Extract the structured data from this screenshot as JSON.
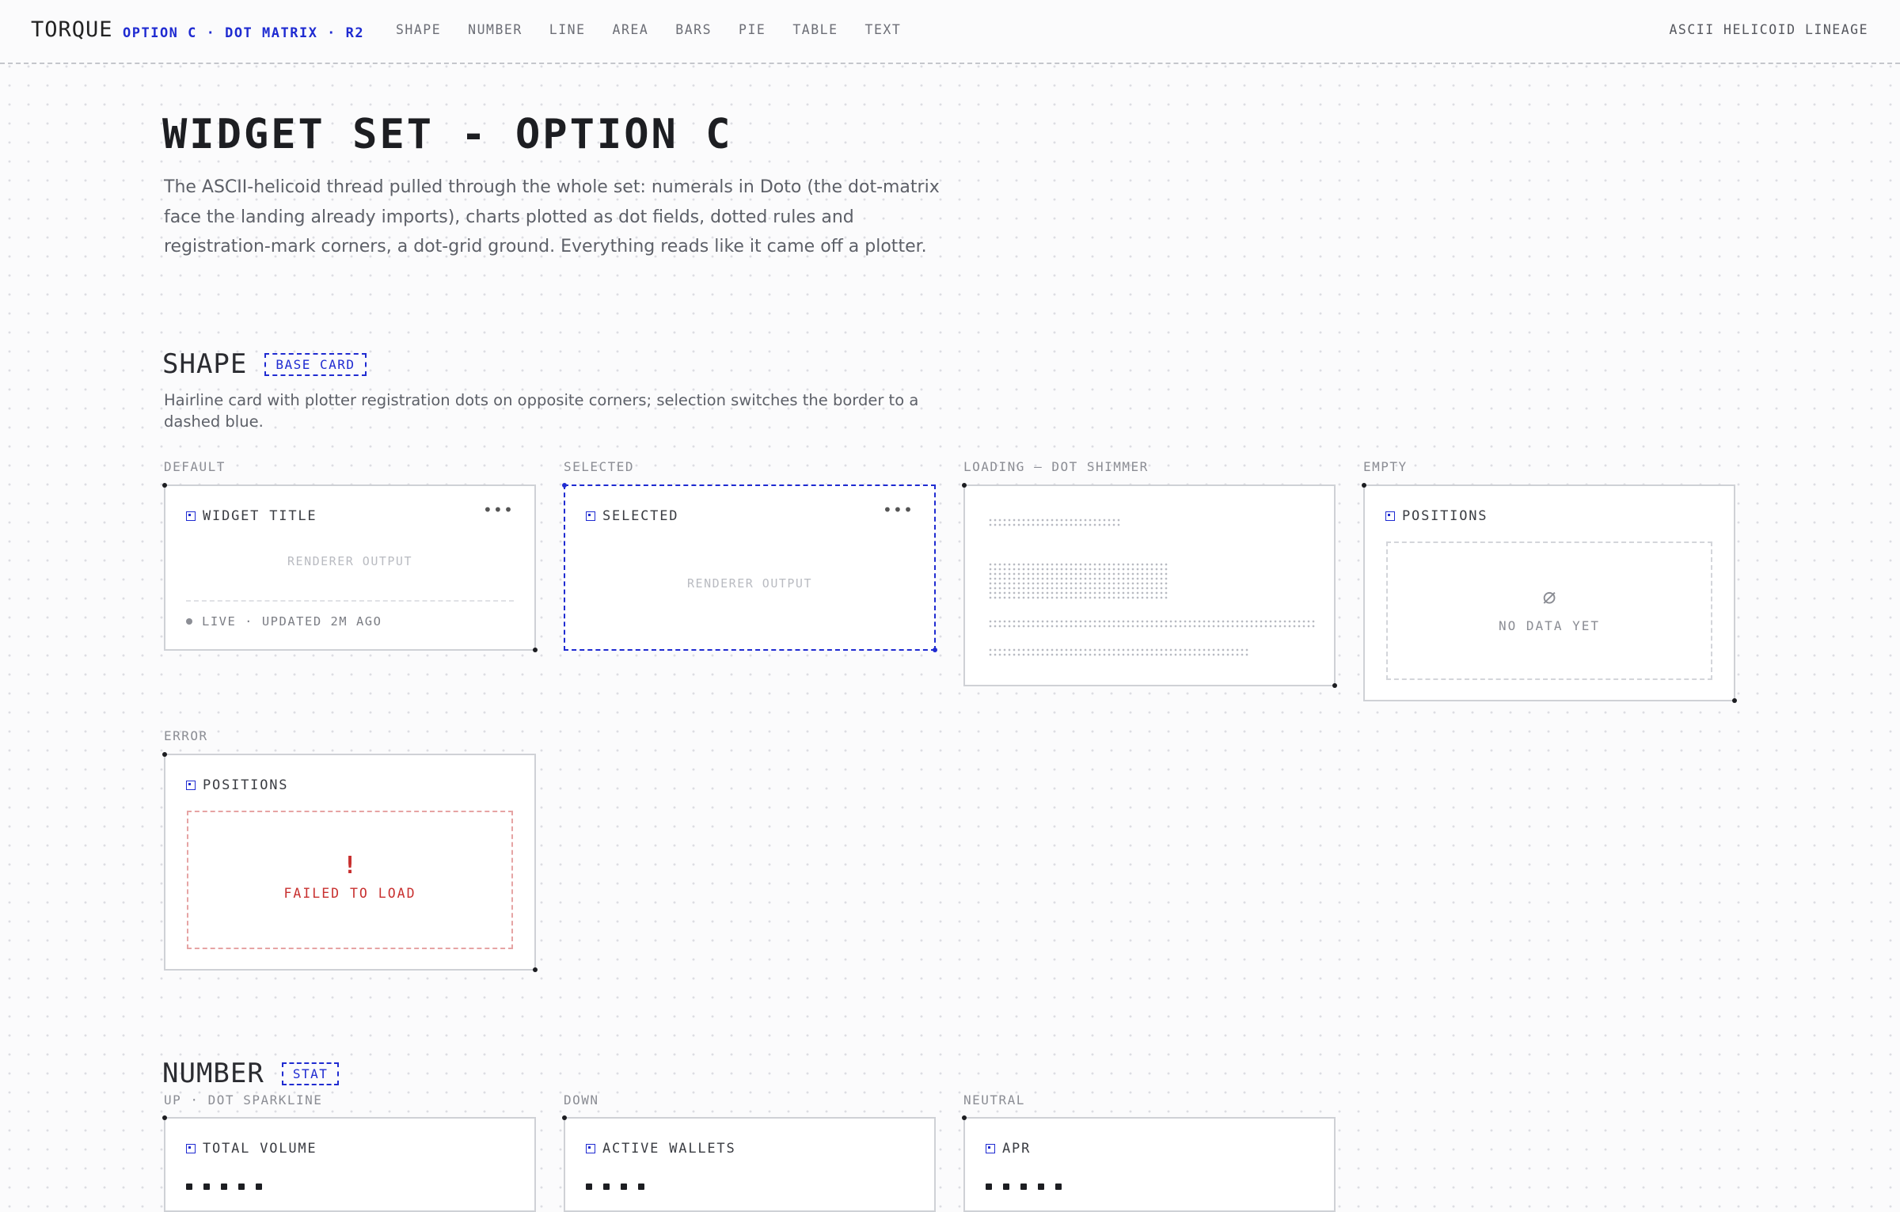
{
  "topbar": {
    "brand": "TORQUE",
    "subtitle": "OPTION C · DOT MATRIX · R2",
    "nav": [
      "SHAPE",
      "NUMBER",
      "LINE",
      "AREA",
      "BARS",
      "PIE",
      "TABLE",
      "TEXT"
    ],
    "lineage": "ASCII HELICOID LINEAGE"
  },
  "hero": {
    "title": "WIDGET SET - OPTION C",
    "intro": "The ASCII-helicoid thread pulled through the whole set: numerals in Doto (the dot-matrix face the landing already imports), charts plotted as dot fields, dotted rules and registration-mark corners, a dot-grid ground. Everything reads like it came off a plotter."
  },
  "shape": {
    "title": "SHAPE",
    "tag": "BASE CARD",
    "description": "Hairline card with plotter registration dots on opposite corners; selection switches the border to a dashed blue.",
    "states": {
      "default": {
        "label": "DEFAULT",
        "card_title": "WIDGET TITLE",
        "menu": "•••",
        "renderer": "RENDERER OUTPUT",
        "footer": "LIVE · UPDATED 2M AGO"
      },
      "selected": {
        "label": "SELECTED",
        "card_title": "SELECTED",
        "menu": "•••",
        "renderer": "RENDERER OUTPUT"
      },
      "loading": {
        "label": "LOADING — DOT SHIMMER"
      },
      "empty": {
        "label": "EMPTY",
        "card_title": "POSITIONS",
        "glyph": "∅",
        "message": "NO DATA YET"
      },
      "error": {
        "label": "ERROR",
        "card_title": "POSITIONS",
        "glyph": "!",
        "message": "FAILED TO LOAD"
      }
    }
  },
  "number": {
    "title": "NUMBER",
    "tag": "STAT",
    "states": {
      "up": {
        "label": "UP · DOT SPARKLINE",
        "card_title": "TOTAL VOLUME"
      },
      "down": {
        "label": "DOWN",
        "card_title": "ACTIVE WALLETS"
      },
      "neutral": {
        "label": "NEUTRAL",
        "card_title": "APR"
      }
    }
  },
  "colors": {
    "accent": "#1f2bd1",
    "error": "#c8302f",
    "ink": "#1d1e22",
    "hairline": "#cfd1d6"
  }
}
